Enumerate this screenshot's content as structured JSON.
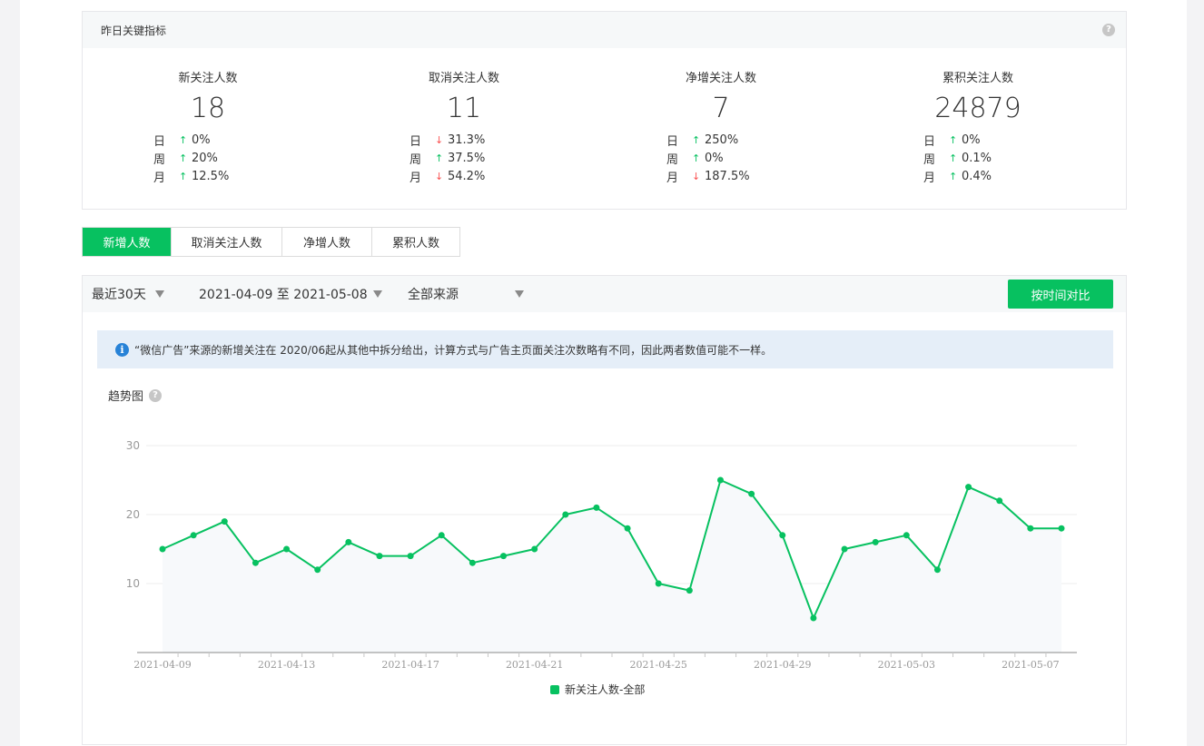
{
  "metrics": {
    "title": "昨日关键指标",
    "help_glyph": "?",
    "items": [
      {
        "label": "新关注人数",
        "value": "18",
        "rows": [
          {
            "period": "日",
            "dir": "up",
            "arrow": "↑",
            "change": "0%"
          },
          {
            "period": "周",
            "dir": "up",
            "arrow": "↑",
            "change": "20%"
          },
          {
            "period": "月",
            "dir": "up",
            "arrow": "↑",
            "change": "12.5%"
          }
        ]
      },
      {
        "label": "取消关注人数",
        "value": "11",
        "rows": [
          {
            "period": "日",
            "dir": "down",
            "arrow": "↓",
            "change": "31.3%"
          },
          {
            "period": "周",
            "dir": "up",
            "arrow": "↑",
            "change": "37.5%"
          },
          {
            "period": "月",
            "dir": "down",
            "arrow": "↓",
            "change": "54.2%"
          }
        ]
      },
      {
        "label": "净增关注人数",
        "value": "7",
        "rows": [
          {
            "period": "日",
            "dir": "up",
            "arrow": "↑",
            "change": "250%"
          },
          {
            "period": "周",
            "dir": "up",
            "arrow": "↑",
            "change": "0%"
          },
          {
            "period": "月",
            "dir": "down",
            "arrow": "↓",
            "change": "187.5%"
          }
        ]
      },
      {
        "label": "累积关注人数",
        "value": "24879",
        "rows": [
          {
            "period": "日",
            "dir": "up",
            "arrow": "↑",
            "change": "0%"
          },
          {
            "period": "周",
            "dir": "up",
            "arrow": "↑",
            "change": "0.1%"
          },
          {
            "period": "月",
            "dir": "up",
            "arrow": "↑",
            "change": "0.4%"
          }
        ]
      }
    ]
  },
  "tabs": [
    {
      "label": "新增人数",
      "active": true
    },
    {
      "label": "取消关注人数",
      "active": false
    },
    {
      "label": "净增人数",
      "active": false
    },
    {
      "label": "累积人数",
      "active": false
    }
  ],
  "filters": {
    "period": "最近30天",
    "date_range": "2021-04-09 至 2021-05-08",
    "source": "全部来源",
    "compare_button": "按时间对比"
  },
  "notice": {
    "icon": "i",
    "text": "“微信广告”来源的新增关注在 2020/06起从其他中拆分给出，计算方式与广告主页面关注次数略有不同，因此两者数值可能不一样。"
  },
  "trend": {
    "title": "趋势图"
  },
  "colors": {
    "accent": "#07c160",
    "down": "#fa5151",
    "info": "#2782d7"
  },
  "chart_data": {
    "type": "line",
    "x": [
      "2021-04-09",
      "2021-04-10",
      "2021-04-11",
      "2021-04-12",
      "2021-04-13",
      "2021-04-14",
      "2021-04-15",
      "2021-04-16",
      "2021-04-17",
      "2021-04-18",
      "2021-04-19",
      "2021-04-20",
      "2021-04-21",
      "2021-04-22",
      "2021-04-23",
      "2021-04-24",
      "2021-04-25",
      "2021-04-26",
      "2021-04-27",
      "2021-04-28",
      "2021-04-29",
      "2021-04-30",
      "2021-05-01",
      "2021-05-02",
      "2021-05-03",
      "2021-05-04",
      "2021-05-05",
      "2021-05-06",
      "2021-05-07",
      "2021-05-08"
    ],
    "series": [
      {
        "name": "新关注人数-全部",
        "values": [
          15,
          17,
          19,
          13,
          15,
          12,
          16,
          14,
          14,
          17,
          13,
          14,
          15,
          20,
          21,
          18,
          10,
          9,
          25,
          23,
          17,
          5,
          15,
          16,
          17,
          12,
          24,
          22,
          18,
          18
        ]
      }
    ],
    "x_tick_labels": [
      "2021-04-09",
      "2021-04-13",
      "2021-04-17",
      "2021-04-21",
      "2021-04-25",
      "2021-04-29",
      "2021-05-03",
      "2021-05-07"
    ],
    "y_ticks": [
      10,
      20,
      30
    ],
    "ylim": [
      0,
      30
    ],
    "grid": true,
    "legend": "bottom-center"
  }
}
